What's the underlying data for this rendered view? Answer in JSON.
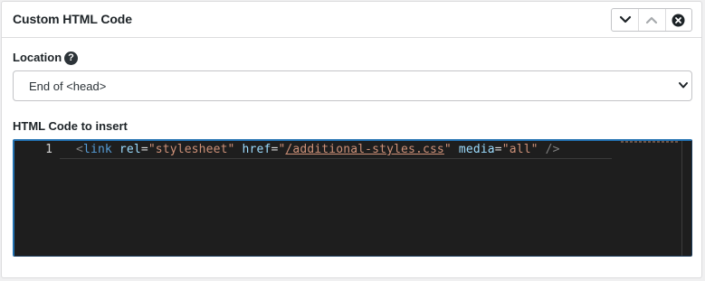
{
  "panel": {
    "title": "Custom HTML Code",
    "controls": {
      "expand_icon": "chevron-down-icon",
      "collapse_icon": "chevron-up-icon",
      "remove_icon": "close-circle-icon"
    }
  },
  "location": {
    "label": "Location",
    "help_glyph": "?",
    "selected": "End of <head>"
  },
  "code": {
    "label": "HTML Code to insert",
    "line_number": "1",
    "tokens": {
      "open": "<",
      "tag": "link",
      "attr1": "rel",
      "eq1": "=",
      "val1": "\"stylesheet\"",
      "attr2": "href",
      "eq2": "=",
      "q_open": "\"",
      "href": "/additional-styles.css",
      "q_close": "\"",
      "attr3": "media",
      "eq3": "=",
      "val3": "\"all\"",
      "close": "/>"
    }
  },
  "colors": {
    "editor_bg": "#1e1e1e",
    "accent": "#2271b1"
  }
}
